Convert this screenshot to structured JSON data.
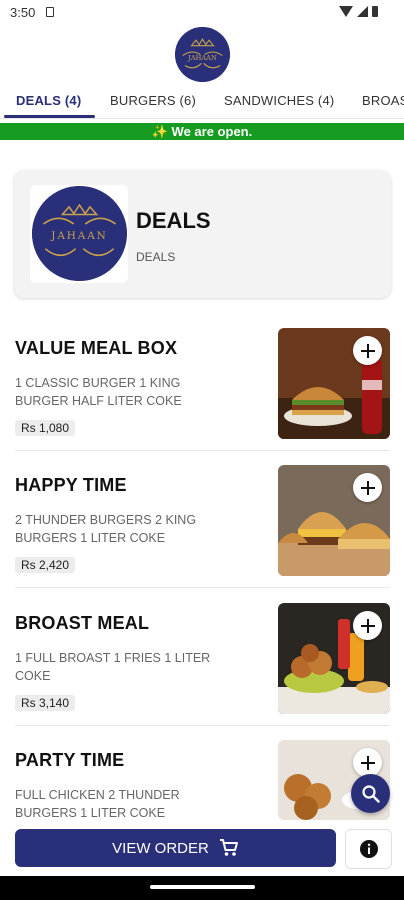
{
  "status_bar": {
    "time": "3:50"
  },
  "brand": {
    "logo_text": "JAHAAN",
    "colors": {
      "primary": "#2a2f7a",
      "gold": "#c8a24a",
      "open_green": "#159c21"
    }
  },
  "tabs": [
    {
      "label": "DEALS (4)",
      "active": true
    },
    {
      "label": "BURGERS (6)",
      "active": false
    },
    {
      "label": "SANDWICHES (4)",
      "active": false
    },
    {
      "label": "BROAS",
      "active": false
    }
  ],
  "banner": {
    "text": "✨ We are open."
  },
  "category": {
    "title": "DEALS",
    "subtitle": "DEALS"
  },
  "items": [
    {
      "name": "VALUE MEAL BOX",
      "description": "1 CLASSIC BURGER 1 KING BURGER HALF LITER COKE",
      "price": "Rs 1,080"
    },
    {
      "name": "HAPPY TIME",
      "description": "2 THUNDER BURGERS 2 KING BURGERS 1 LITER COKE",
      "price": "Rs 2,420"
    },
    {
      "name": "BROAST MEAL",
      "description": "1 FULL BROAST 1 FRIES 1 LITER COKE",
      "price": "Rs 3,140"
    },
    {
      "name": "PARTY TIME",
      "description": "FULL CHICKEN 2 THUNDER BURGERS 1 LITER COKE",
      "price": ""
    }
  ],
  "bottom": {
    "view_order_label": "VIEW ORDER"
  },
  "icons": {
    "add": "plus-icon",
    "search": "search-icon",
    "cart": "cart-icon",
    "info": "info-icon"
  }
}
